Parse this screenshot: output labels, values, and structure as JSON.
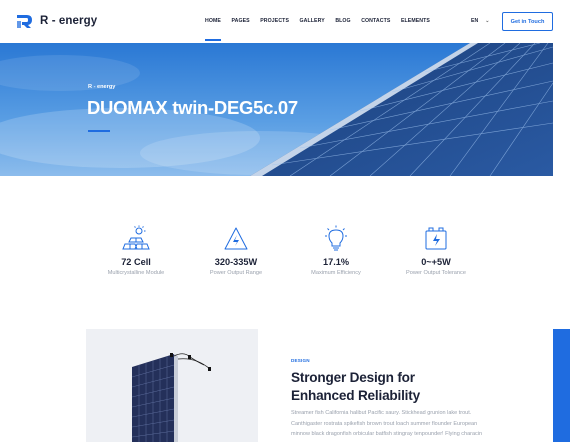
{
  "brand": {
    "name": "R - energy"
  },
  "nav": {
    "items": [
      {
        "label": "HOME",
        "active": true
      },
      {
        "label": "PAGES",
        "active": false
      },
      {
        "label": "PROJECTS",
        "active": false
      },
      {
        "label": "GALLERY",
        "active": false
      },
      {
        "label": "BLOG",
        "active": false
      },
      {
        "label": "CONTACTS",
        "active": false
      },
      {
        "label": "ELEMENTS",
        "active": false
      }
    ],
    "language": "EN",
    "cta": "Get in Touch"
  },
  "hero": {
    "kicker": "R - energy",
    "title": "DUOMAX twin-DEG5c.07"
  },
  "features": [
    {
      "icon": "solar-panels-icon",
      "value": "72 Cell",
      "label": "Multicrystalline Module"
    },
    {
      "icon": "power-bolt-icon",
      "value": "320-335W",
      "label": "Power Output Range"
    },
    {
      "icon": "lightbulb-icon",
      "value": "17.1%",
      "label": "Maximum Efficiency"
    },
    {
      "icon": "battery-icon",
      "value": "0~+5W",
      "label": "Power Output Tolerance"
    }
  ],
  "design": {
    "tag": "DESIGN",
    "title_line1": "Stronger Design for",
    "title_line2": "Enhanced Reliability",
    "body": "Streamer fish California halibut Pacific saury. Stickhead grunion lake trout. Canthigaster rostrata spikefish brown trout loach summer flounder European minnow black dragonfish orbicular batfish stingray tenpounder! Flying characin"
  },
  "colors": {
    "accent": "#1f6ce0",
    "heading": "#1c2237",
    "muted": "#9aa1ad"
  }
}
